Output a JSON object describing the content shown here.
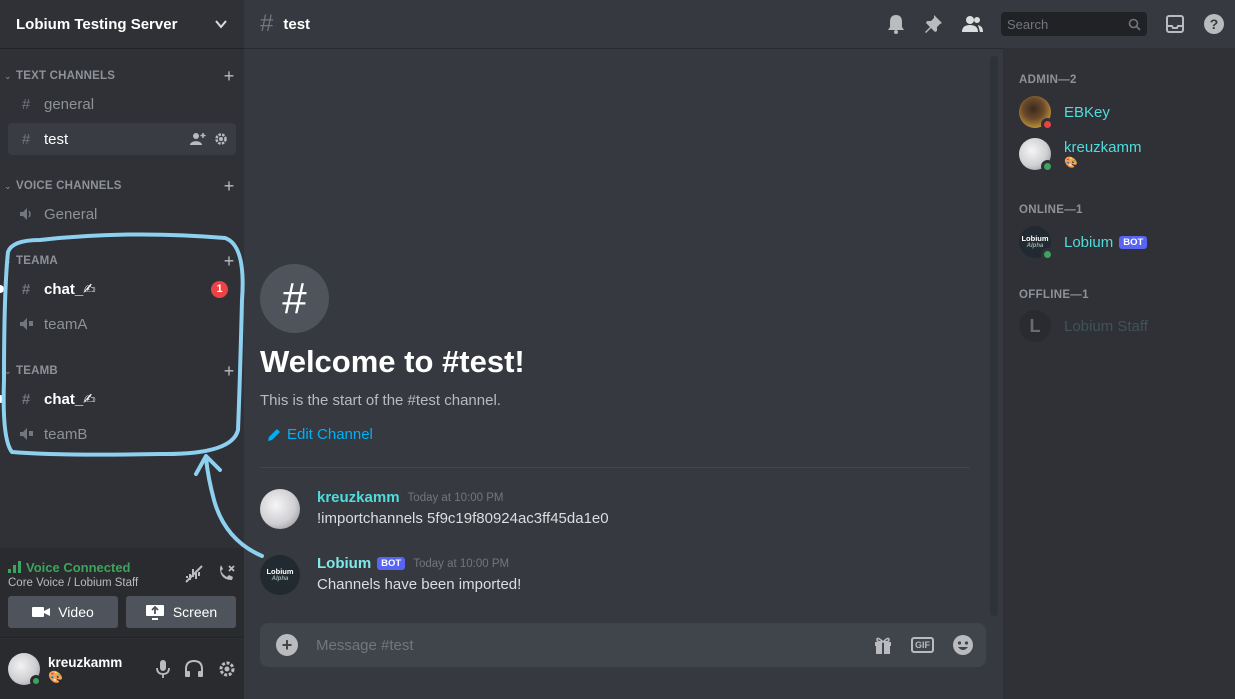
{
  "server": {
    "name": "Lobium Testing Server"
  },
  "categories": {
    "text": "TEXT CHANNELS",
    "voice": "VOICE CHANNELS",
    "teama": "TEAMA",
    "teamb": "TEAMB"
  },
  "channels": {
    "general": "general",
    "test": "test",
    "voice_general": "General",
    "teama_chat": "chat_✍",
    "teama_voice": "teamA",
    "teama_badge": "1",
    "teamb_chat": "chat_✍",
    "teamb_voice": "teamB"
  },
  "voice": {
    "status": "Voice Connected",
    "location": "Core Voice / Lobium Staff",
    "video_label": "Video",
    "screen_label": "Screen"
  },
  "user": {
    "name": "kreuzkamm",
    "status_emoji": "🎨"
  },
  "topbar": {
    "channel": "test",
    "search_placeholder": "Search"
  },
  "welcome": {
    "title": "Welcome to #test!",
    "subtitle": "This is the start of the #test channel.",
    "edit": "Edit Channel"
  },
  "messages": [
    {
      "author": "kreuzkamm",
      "bot": false,
      "time": "Today at 10:00 PM",
      "text": "!importchannels 5f9c19f80924ac3ff45da1e0"
    },
    {
      "author": "Lobium",
      "bot": true,
      "bot_tag": "BOT",
      "time": "Today at 10:00 PM",
      "text": "Channels have been imported!",
      "avatar_line1": "Lobium",
      "avatar_line2": "Alpha"
    }
  ],
  "composer": {
    "placeholder": "Message #test",
    "gif": "GIF"
  },
  "members": {
    "admin_header": "ADMIN—2",
    "online_header": "ONLINE—1",
    "offline_header": "OFFLINE—1",
    "admin": [
      {
        "name": "EBKey",
        "status": "dnd"
      },
      {
        "name": "kreuzkamm",
        "status": "online",
        "sub": "🎨"
      }
    ],
    "online": [
      {
        "name": "Lobium",
        "bot_tag": "BOT",
        "status": "online",
        "avatar_line1": "Lobium",
        "avatar_line2": "Alpha"
      }
    ],
    "offline": [
      {
        "name": "Lobium Staff",
        "initial": "L"
      }
    ]
  },
  "colors": {
    "accent_cyan": "#4fdcdc",
    "online": "#3ba55d",
    "dnd": "#ed4245",
    "bot_tag": "#5865f2",
    "annotation": "#8ed0f0"
  }
}
